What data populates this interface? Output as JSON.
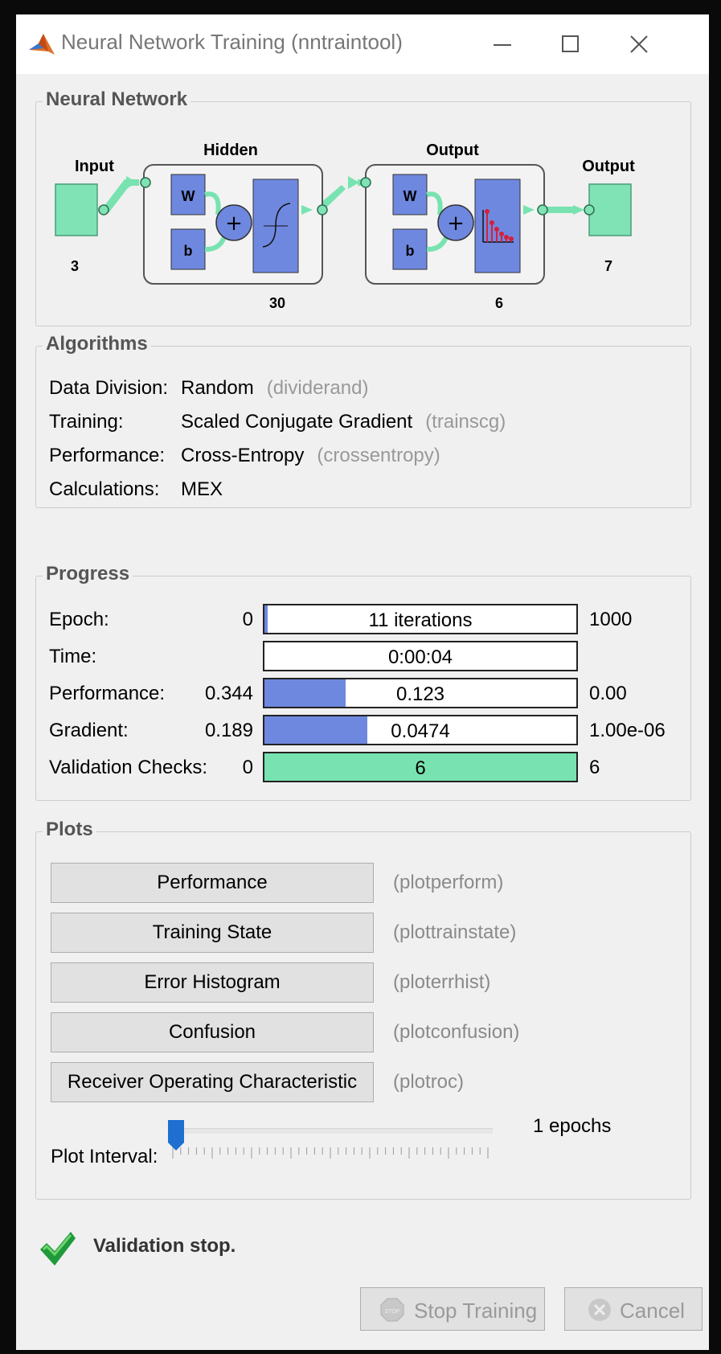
{
  "window": {
    "title": "Neural Network Training (nntraintool)"
  },
  "neural_network": {
    "title": "Neural Network",
    "input_label": "Input",
    "input_size": "3",
    "hidden_label": "Hidden",
    "hidden_size": "30",
    "output_layer_label": "Output",
    "output_layer_size": "6",
    "output_label": "Output",
    "output_size": "7",
    "weight_symbol": "W",
    "bias_symbol": "b"
  },
  "algorithms": {
    "title": "Algorithms",
    "rows": [
      {
        "label": "Data Division:",
        "value": "Random",
        "fn": "(dividerand)"
      },
      {
        "label": "Training:",
        "value": "Scaled Conjugate Gradient",
        "fn": "(trainscg)"
      },
      {
        "label": "Performance:",
        "value": "Cross-Entropy",
        "fn": "(crossentropy)"
      },
      {
        "label": "Calculations:",
        "value": "MEX",
        "fn": ""
      }
    ]
  },
  "progress": {
    "title": "Progress",
    "rows": [
      {
        "label": "Epoch:",
        "min": "0",
        "text": "11 iterations",
        "max": "1000",
        "fraction": 0.011,
        "green": false
      },
      {
        "label": "Time:",
        "min": "",
        "text": "0:00:04",
        "max": "",
        "fraction": 0,
        "green": false
      },
      {
        "label": "Performance:",
        "min": "0.344",
        "text": "0.123",
        "max": "0.00",
        "fraction": 0.26,
        "green": false
      },
      {
        "label": "Gradient:",
        "min": "0.189",
        "text": "0.0474",
        "max": "1.00e-06",
        "fraction": 0.33,
        "green": false
      },
      {
        "label": "Validation Checks:",
        "min": "0",
        "text": "6",
        "max": "6",
        "fraction": 1.0,
        "green": true
      }
    ]
  },
  "plots": {
    "title": "Plots",
    "buttons": [
      {
        "label": "Performance",
        "fn": "(plotperform)"
      },
      {
        "label": "Training State",
        "fn": "(plottrainstate)"
      },
      {
        "label": "Error Histogram",
        "fn": "(ploterrhist)"
      },
      {
        "label": "Confusion",
        "fn": "(plotconfusion)"
      },
      {
        "label": "Receiver Operating Characteristic",
        "fn": "(plotroc)"
      }
    ],
    "interval_label": "Plot Interval:",
    "interval_value": "1 epochs",
    "slider_fraction": 0.0
  },
  "status": {
    "text": "Validation stop."
  },
  "footer": {
    "stop_label": "Stop Training",
    "stop_icon_text": "STOP",
    "cancel_label": "Cancel"
  },
  "colors": {
    "layer_blue": "#6f88df",
    "connector_green": "#78e3b0",
    "check_green": "#1e9a3a",
    "slider_blue": "#1f6fd1"
  }
}
